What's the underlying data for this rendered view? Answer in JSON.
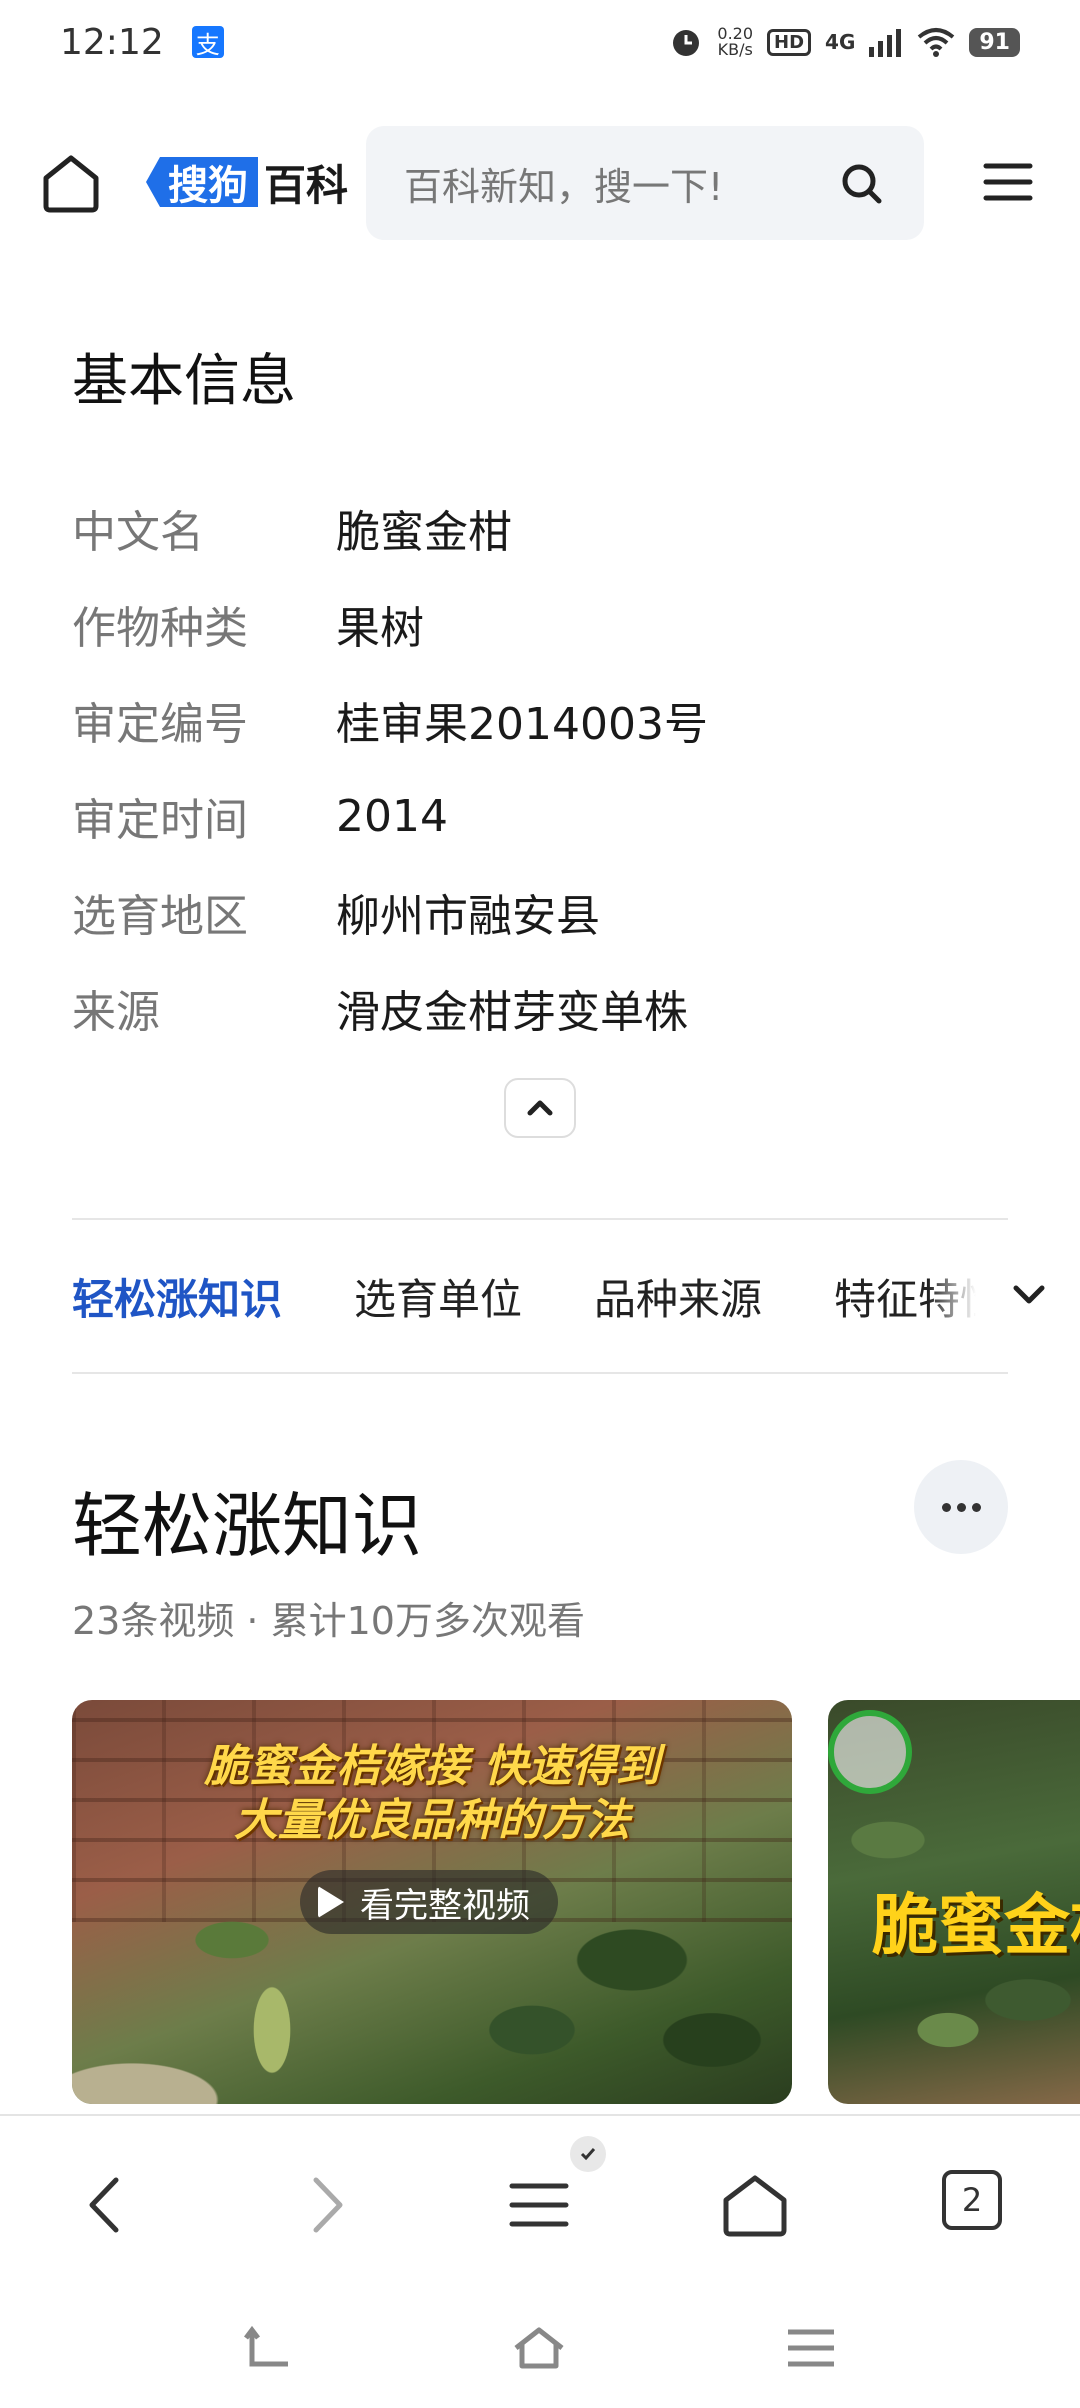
{
  "status_bar": {
    "time": "12:12",
    "net_speed_value": "0.20",
    "net_speed_unit": "KB/s",
    "hd": "HD",
    "network": "4G",
    "battery": "91"
  },
  "header": {
    "brand_sogou": "搜狗",
    "brand_baike": "百科",
    "search_placeholder": "百科新知，搜一下!"
  },
  "basic_info": {
    "title": "基本信息",
    "rows": [
      {
        "key": "中文名",
        "value": "脆蜜金柑"
      },
      {
        "key": "作物种类",
        "value": "果树"
      },
      {
        "key": "审定编号",
        "value": "桂审果2014003号"
      },
      {
        "key": "审定时间",
        "value": "2014"
      },
      {
        "key": "选育地区",
        "value": "柳州市融安县"
      },
      {
        "key": "来源",
        "value": "滑皮金柑芽变单株"
      }
    ]
  },
  "tabs": {
    "items": [
      "轻松涨知识",
      "选育单位",
      "品种来源",
      "特征特性"
    ],
    "active_index": 0
  },
  "knowledge": {
    "title": "轻松涨知识",
    "meta": "23条视频 · 累计10万多次观看",
    "videos": [
      {
        "caption_line1": "脆蜜金桔嫁接 快速得到",
        "caption_line2": "大量优良品种的方法",
        "play_label": "看完整视频"
      },
      {
        "caption": "脆蜜金柑"
      }
    ]
  },
  "browser_nav": {
    "tab_count": "2"
  }
}
